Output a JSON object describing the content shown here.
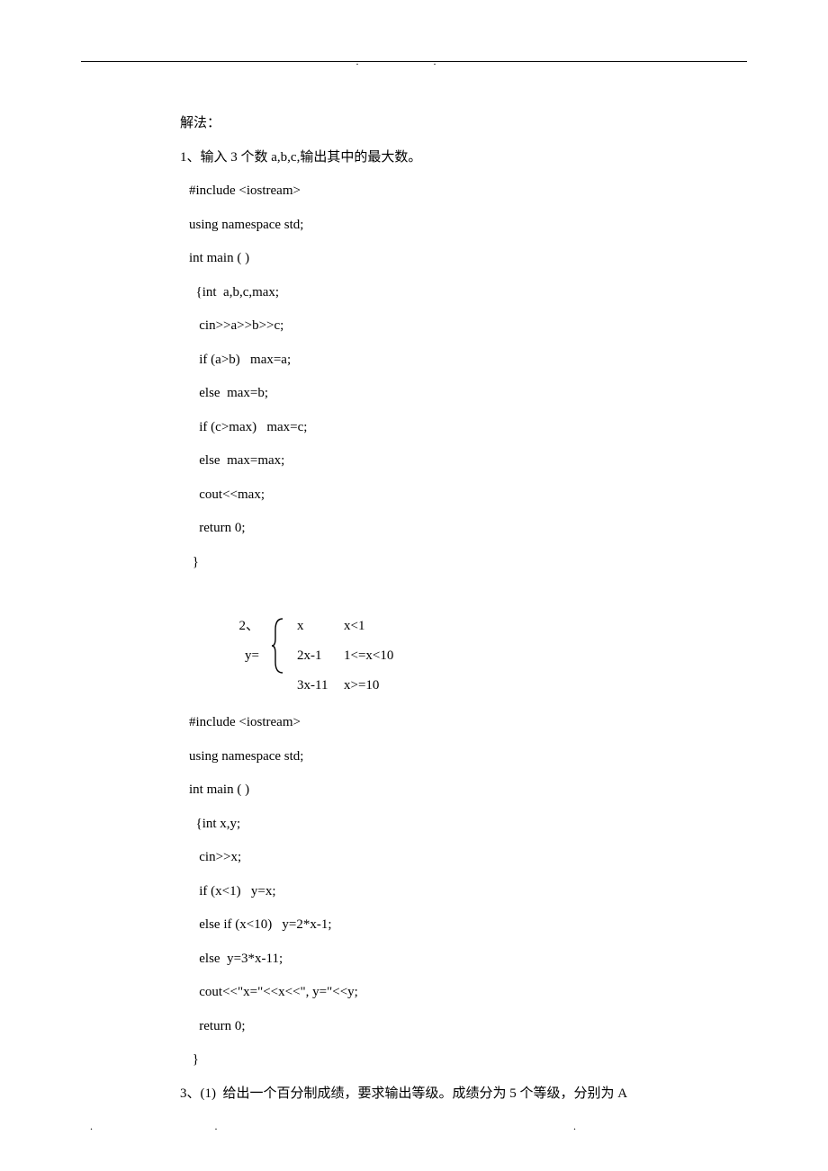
{
  "header_dots": ". .",
  "sec1": {
    "title": "解法：",
    "prompt": "1、输入 3 个数 a,b,c,输出其中的最大数。",
    "code": [
      "#include <iostream>",
      "using namespace std;",
      "int main ( )",
      "  {int  a,b,c,max;",
      "   cin>>a>>b>>c;",
      "   if (a>b)   max=a;",
      "   else  max=b;",
      "   if (c>max)   max=c;",
      "   else  max=max;",
      "   cout<<max;",
      "   return 0;",
      " }"
    ]
  },
  "sec2": {
    "prompt_prefix": "2、",
    "y_label": "y=",
    "rows": [
      {
        "expr": "x",
        "cond": "x<1"
      },
      {
        "expr": "2x-1",
        "cond": "1<=x<10"
      },
      {
        "expr": "3x-11",
        "cond": "x>=10"
      }
    ],
    "code": [
      "#include <iostream>",
      "using namespace std;",
      "int main ( )",
      "  {int x,y;",
      "   cin>>x;",
      "   if (x<1)   y=x;",
      "   else if (x<10)   y=2*x-1;",
      "   else  y=3*x-11;",
      "   cout<<\"x=\"<<x<<\", y=\"<<y;",
      "   return 0;",
      " }"
    ]
  },
  "sec3": {
    "prompt": "3、(1)  给出一个百分制成绩，要求输出等级。成绩分为 5 个等级，分别为 A"
  },
  "footer": {
    "d1": ".",
    "d2": ".",
    "d3": "."
  }
}
